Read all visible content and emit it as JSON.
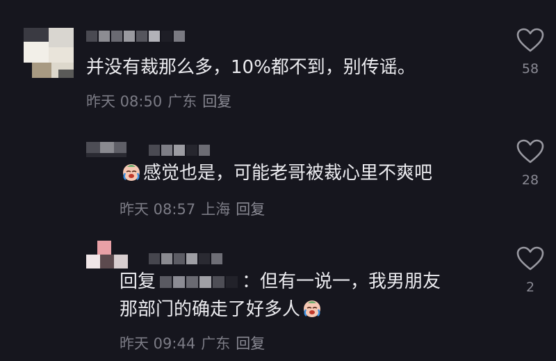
{
  "comments": [
    {
      "text": "并没有裁那么多，10%都不到，别传谣。",
      "time": "昨天 08:50",
      "location": "广东",
      "reply_label": "回复",
      "likes": "58"
    },
    {
      "text": "感觉也是，可能老哥被裁心里不爽吧",
      "time": "昨天 08:57",
      "location": "上海",
      "reply_label": "回复",
      "likes": "28"
    },
    {
      "reply_prefix": "回复",
      "line1_tail": "：但有一说一，我男朋友",
      "line2": "那部门的确走了好多人",
      "time": "昨天 09:44",
      "location": "广东",
      "reply_label": "回复",
      "likes": "2"
    }
  ],
  "icons": [
    "heart-icon",
    "crying-emoji-icon"
  ],
  "colors": {
    "background": "#16161e",
    "text": "#ececf0",
    "meta": "#7c7c86"
  }
}
